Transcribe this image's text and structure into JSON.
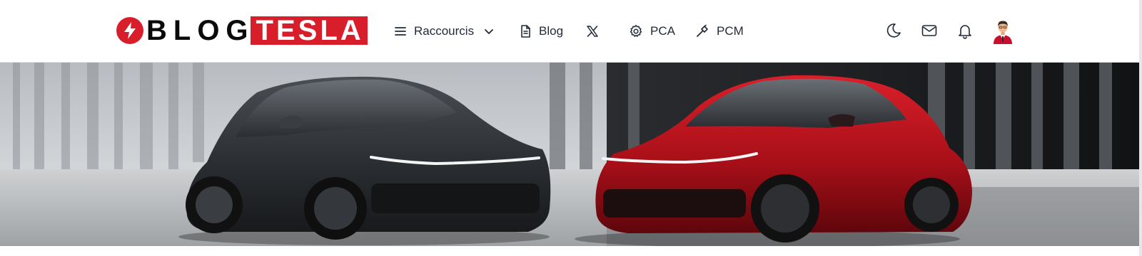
{
  "brand": {
    "logo_blog": "BLOG",
    "logo_tesla": "TESLA",
    "accent_color": "#d81e2a"
  },
  "nav": {
    "items": [
      {
        "label": "Raccourcis",
        "icon": "menu-icon",
        "has_dropdown": true
      },
      {
        "label": "Blog",
        "icon": "document-icon"
      },
      {
        "label": "",
        "icon": "x-logo-icon"
      },
      {
        "label": "PCA",
        "icon": "gear-icon"
      },
      {
        "label": "PCM",
        "icon": "hammer-icon"
      }
    ]
  },
  "actions": {
    "items": [
      {
        "icon": "moon-icon"
      },
      {
        "icon": "mail-icon"
      },
      {
        "icon": "bell-icon"
      },
      {
        "icon": "avatar"
      }
    ]
  },
  "hero": {
    "image": "two Tesla Model Y cars, dark grey and red, parked in front of vertical concrete pillars",
    "car_colors": [
      "#2f3236",
      "#b5121b"
    ]
  }
}
